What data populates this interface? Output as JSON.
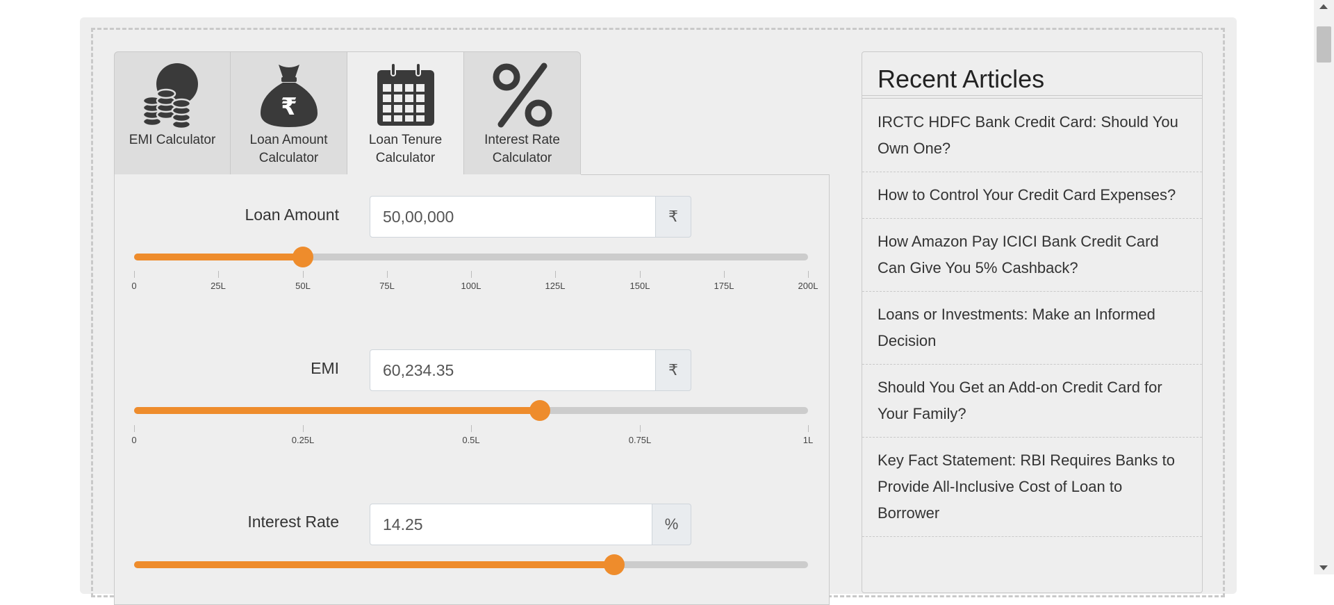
{
  "tabs": [
    {
      "label": "EMI Calculator",
      "icon": "coins-icon",
      "active": false
    },
    {
      "label": "Loan Amount Calculator",
      "icon": "rupee-bag-icon",
      "active": false
    },
    {
      "label": "Loan Tenure Calculator",
      "icon": "calendar-icon",
      "active": true
    },
    {
      "label": "Interest Rate Calculator",
      "icon": "percent-icon",
      "active": false
    }
  ],
  "fields": {
    "loan_amount": {
      "label": "Loan Amount",
      "value": "50,00,000",
      "unit": "₹",
      "slider_fraction": 0.25,
      "ticks": [
        "0",
        "25L",
        "50L",
        "75L",
        "100L",
        "125L",
        "150L",
        "175L",
        "200L"
      ]
    },
    "emi": {
      "label": "EMI",
      "value": "60,234.35",
      "unit": "₹",
      "slider_fraction": 0.6023,
      "ticks": [
        "0",
        "0.25L",
        "0.5L",
        "0.75L",
        "1L"
      ]
    },
    "interest_rate": {
      "label": "Interest Rate",
      "value": "14.25",
      "unit": "%",
      "slider_fraction": 0.7125
    }
  },
  "sidebar": {
    "title": "Recent Articles",
    "articles": [
      "IRCTC HDFC Bank Credit Card: Should You Own One?",
      "How to Control Your Credit Card Expenses?",
      "How Amazon Pay ICICI Bank Credit Card Can Give You 5% Cashback?",
      "Loans or Investments: Make an Informed Decision",
      "Should You Get an Add-on Credit Card for Your Family?",
      "Key Fact Statement: RBI Requires Banks to Provide All-Inclusive Cost of Loan to Borrower"
    ]
  },
  "colors": {
    "accent": "#ee8c2c",
    "track": "#cccccc",
    "panel_bg": "#eeeeee",
    "icon": "#3a3a3a"
  }
}
